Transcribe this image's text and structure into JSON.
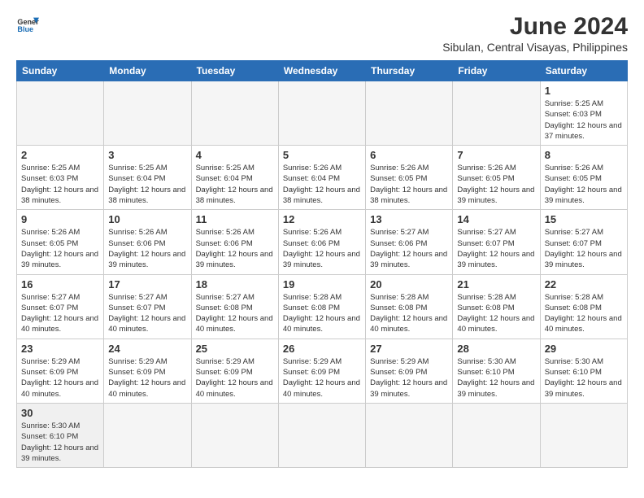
{
  "logo": {
    "text_general": "General",
    "text_blue": "Blue"
  },
  "title": "June 2024",
  "subtitle": "Sibulan, Central Visayas, Philippines",
  "days_of_week": [
    "Sunday",
    "Monday",
    "Tuesday",
    "Wednesday",
    "Thursday",
    "Friday",
    "Saturday"
  ],
  "weeks": [
    [
      {
        "day": "",
        "info": "",
        "empty": true
      },
      {
        "day": "",
        "info": "",
        "empty": true
      },
      {
        "day": "",
        "info": "",
        "empty": true
      },
      {
        "day": "",
        "info": "",
        "empty": true
      },
      {
        "day": "",
        "info": "",
        "empty": true
      },
      {
        "day": "",
        "info": "",
        "empty": true
      },
      {
        "day": "1",
        "info": "Sunrise: 5:25 AM\nSunset: 6:03 PM\nDaylight: 12 hours and 37 minutes."
      }
    ],
    [
      {
        "day": "2",
        "info": "Sunrise: 5:25 AM\nSunset: 6:03 PM\nDaylight: 12 hours and 38 minutes."
      },
      {
        "day": "3",
        "info": "Sunrise: 5:25 AM\nSunset: 6:04 PM\nDaylight: 12 hours and 38 minutes."
      },
      {
        "day": "4",
        "info": "Sunrise: 5:25 AM\nSunset: 6:04 PM\nDaylight: 12 hours and 38 minutes."
      },
      {
        "day": "5",
        "info": "Sunrise: 5:26 AM\nSunset: 6:04 PM\nDaylight: 12 hours and 38 minutes."
      },
      {
        "day": "6",
        "info": "Sunrise: 5:26 AM\nSunset: 6:05 PM\nDaylight: 12 hours and 38 minutes."
      },
      {
        "day": "7",
        "info": "Sunrise: 5:26 AM\nSunset: 6:05 PM\nDaylight: 12 hours and 39 minutes."
      },
      {
        "day": "8",
        "info": "Sunrise: 5:26 AM\nSunset: 6:05 PM\nDaylight: 12 hours and 39 minutes."
      }
    ],
    [
      {
        "day": "9",
        "info": "Sunrise: 5:26 AM\nSunset: 6:05 PM\nDaylight: 12 hours and 39 minutes."
      },
      {
        "day": "10",
        "info": "Sunrise: 5:26 AM\nSunset: 6:06 PM\nDaylight: 12 hours and 39 minutes."
      },
      {
        "day": "11",
        "info": "Sunrise: 5:26 AM\nSunset: 6:06 PM\nDaylight: 12 hours and 39 minutes."
      },
      {
        "day": "12",
        "info": "Sunrise: 5:26 AM\nSunset: 6:06 PM\nDaylight: 12 hours and 39 minutes."
      },
      {
        "day": "13",
        "info": "Sunrise: 5:27 AM\nSunset: 6:06 PM\nDaylight: 12 hours and 39 minutes."
      },
      {
        "day": "14",
        "info": "Sunrise: 5:27 AM\nSunset: 6:07 PM\nDaylight: 12 hours and 39 minutes."
      },
      {
        "day": "15",
        "info": "Sunrise: 5:27 AM\nSunset: 6:07 PM\nDaylight: 12 hours and 39 minutes."
      }
    ],
    [
      {
        "day": "16",
        "info": "Sunrise: 5:27 AM\nSunset: 6:07 PM\nDaylight: 12 hours and 40 minutes."
      },
      {
        "day": "17",
        "info": "Sunrise: 5:27 AM\nSunset: 6:07 PM\nDaylight: 12 hours and 40 minutes."
      },
      {
        "day": "18",
        "info": "Sunrise: 5:27 AM\nSunset: 6:08 PM\nDaylight: 12 hours and 40 minutes."
      },
      {
        "day": "19",
        "info": "Sunrise: 5:28 AM\nSunset: 6:08 PM\nDaylight: 12 hours and 40 minutes."
      },
      {
        "day": "20",
        "info": "Sunrise: 5:28 AM\nSunset: 6:08 PM\nDaylight: 12 hours and 40 minutes."
      },
      {
        "day": "21",
        "info": "Sunrise: 5:28 AM\nSunset: 6:08 PM\nDaylight: 12 hours and 40 minutes."
      },
      {
        "day": "22",
        "info": "Sunrise: 5:28 AM\nSunset: 6:08 PM\nDaylight: 12 hours and 40 minutes."
      }
    ],
    [
      {
        "day": "23",
        "info": "Sunrise: 5:29 AM\nSunset: 6:09 PM\nDaylight: 12 hours and 40 minutes."
      },
      {
        "day": "24",
        "info": "Sunrise: 5:29 AM\nSunset: 6:09 PM\nDaylight: 12 hours and 40 minutes."
      },
      {
        "day": "25",
        "info": "Sunrise: 5:29 AM\nSunset: 6:09 PM\nDaylight: 12 hours and 40 minutes."
      },
      {
        "day": "26",
        "info": "Sunrise: 5:29 AM\nSunset: 6:09 PM\nDaylight: 12 hours and 40 minutes."
      },
      {
        "day": "27",
        "info": "Sunrise: 5:29 AM\nSunset: 6:09 PM\nDaylight: 12 hours and 39 minutes."
      },
      {
        "day": "28",
        "info": "Sunrise: 5:30 AM\nSunset: 6:10 PM\nDaylight: 12 hours and 39 minutes."
      },
      {
        "day": "29",
        "info": "Sunrise: 5:30 AM\nSunset: 6:10 PM\nDaylight: 12 hours and 39 minutes."
      }
    ],
    [
      {
        "day": "30",
        "info": "Sunrise: 5:30 AM\nSunset: 6:10 PM\nDaylight: 12 hours and 39 minutes.",
        "last": true
      },
      {
        "day": "",
        "info": "",
        "empty": true
      },
      {
        "day": "",
        "info": "",
        "empty": true
      },
      {
        "day": "",
        "info": "",
        "empty": true
      },
      {
        "day": "",
        "info": "",
        "empty": true
      },
      {
        "day": "",
        "info": "",
        "empty": true
      },
      {
        "day": "",
        "info": "",
        "empty": true
      }
    ]
  ]
}
